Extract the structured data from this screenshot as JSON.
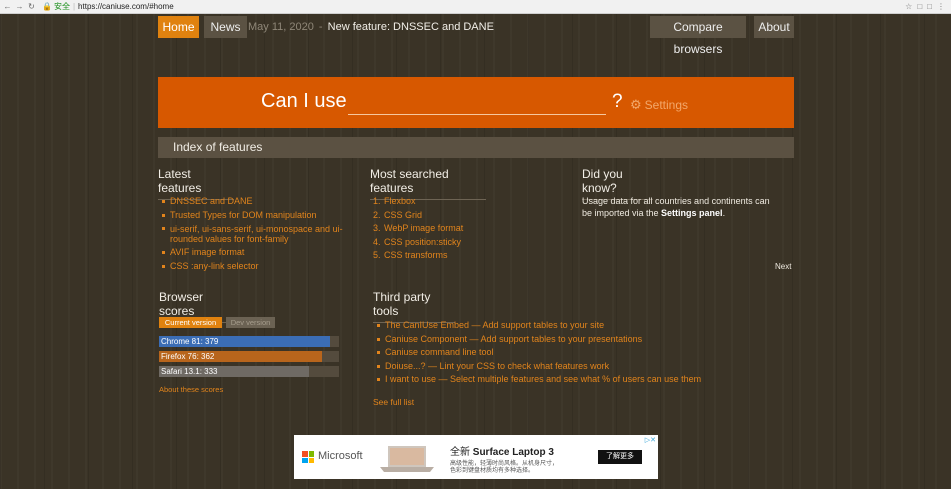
{
  "browser": {
    "secure_label": "安全",
    "url": "https://caniuse.com/#home"
  },
  "nav": {
    "home": "Home",
    "news": "News",
    "news_date": "May 11, 2020",
    "news_sep": "-",
    "news_headline": "New feature: DNSSEC and DANE",
    "compare": "Compare browsers",
    "about": "About"
  },
  "search": {
    "label": "Can I use",
    "value": "",
    "qmark": "?",
    "settings": "Settings"
  },
  "index": {
    "title": "Index of features"
  },
  "latest": {
    "title": "Latest features",
    "items": [
      "DNSSEC and DANE",
      "Trusted Types for DOM manipulation",
      "ui-serif, ui-sans-serif, ui-monospace and ui-rounded values for font-family",
      "AVIF image format",
      "CSS :any-link selector"
    ]
  },
  "most": {
    "title": "Most searched features",
    "items": [
      {
        "n": "1.",
        "label": "Flexbox"
      },
      {
        "n": "2.",
        "label": "CSS Grid"
      },
      {
        "n": "3.",
        "label": "WebP image format"
      },
      {
        "n": "4.",
        "label": "CSS position:sticky"
      },
      {
        "n": "5.",
        "label": "CSS transforms"
      }
    ]
  },
  "dyk": {
    "title": "Did you know?",
    "text_before": "Usage data for all countries and continents can be imported via the ",
    "text_bold": "Settings panel",
    "text_after": ".",
    "next": "Next"
  },
  "scores": {
    "title": "Browser scores",
    "tab_current": "Current version",
    "tab_dev": "Dev version",
    "bars": [
      {
        "label": "Chrome 81: 379",
        "value": 379,
        "color": "#3b6db5"
      },
      {
        "label": "Firefox 76: 362",
        "value": 362,
        "color": "#b8651c"
      },
      {
        "label": "Safari 13.1: 333",
        "value": 333,
        "color": "#6f6a64"
      }
    ],
    "about_link": "About these scores"
  },
  "third": {
    "title": "Third party tools",
    "items": [
      "The CanIUse Embed — Add support tables to your site",
      "Caniuse Component — Add support tables to your presentations",
      "Caniuse command line tool",
      "Doiuse...? — Lint your CSS to check what features work",
      "I want to use — Select multiple features and see what % of users can use them"
    ],
    "see_full": "See full list"
  },
  "ad": {
    "brand": "Microsoft",
    "headline_pre": "全新 ",
    "headline_bold": "Surface Laptop 3",
    "desc1": "高级性能，轻薄时尚风格。从机身尺寸，",
    "desc2": "色彩到键盘材质均有多种选择。",
    "cta": "了解更多",
    "adchoices": "▷✕"
  }
}
